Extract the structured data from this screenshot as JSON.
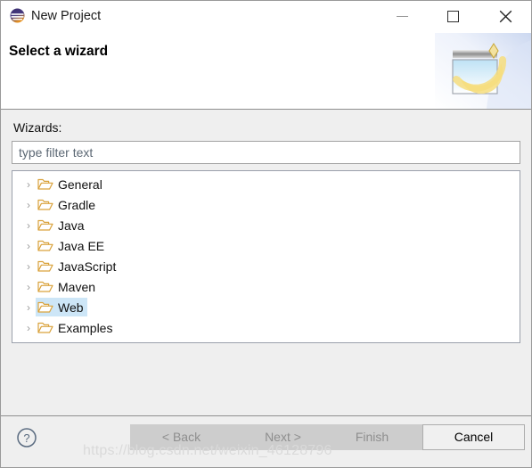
{
  "window": {
    "title": "New Project",
    "app_icon": "eclipse-sphere-icon",
    "controls": {
      "minimize_label": "—",
      "maximize_label": "□",
      "close_label": "✕"
    }
  },
  "header": {
    "title": "Select a wizard",
    "banner_icon": "new-project-banner-icon"
  },
  "body": {
    "wizards_label": "Wizards:",
    "filter": {
      "value": "",
      "placeholder": "type filter text"
    },
    "tree": {
      "twisty_glyph": "›",
      "items": [
        {
          "label": "General",
          "selected": false,
          "icon": "folder-icon"
        },
        {
          "label": "Gradle",
          "selected": false,
          "icon": "folder-icon"
        },
        {
          "label": "Java",
          "selected": false,
          "icon": "folder-icon"
        },
        {
          "label": "Java EE",
          "selected": false,
          "icon": "folder-icon"
        },
        {
          "label": "JavaScript",
          "selected": false,
          "icon": "folder-icon"
        },
        {
          "label": "Maven",
          "selected": false,
          "icon": "folder-icon"
        },
        {
          "label": "Web",
          "selected": true,
          "icon": "folder-icon"
        },
        {
          "label": "Examples",
          "selected": false,
          "icon": "folder-icon"
        }
      ]
    }
  },
  "footer": {
    "help_icon": "help-question-icon",
    "buttons": {
      "back": {
        "label": "< Back",
        "enabled": false
      },
      "next": {
        "label": "Next >",
        "enabled": false
      },
      "finish": {
        "label": "Finish",
        "enabled": false
      },
      "cancel": {
        "label": "Cancel",
        "enabled": true
      }
    }
  },
  "watermark": "https://blog.csdn.net/weixin_46128796",
  "colors": {
    "selection": "#cde6f7",
    "folder": "#d9a23c",
    "dialog_bg": "#efefef",
    "header_bg": "#ffffff",
    "disabled_button": "#cdcdcd",
    "border": "#8f8f8f"
  }
}
